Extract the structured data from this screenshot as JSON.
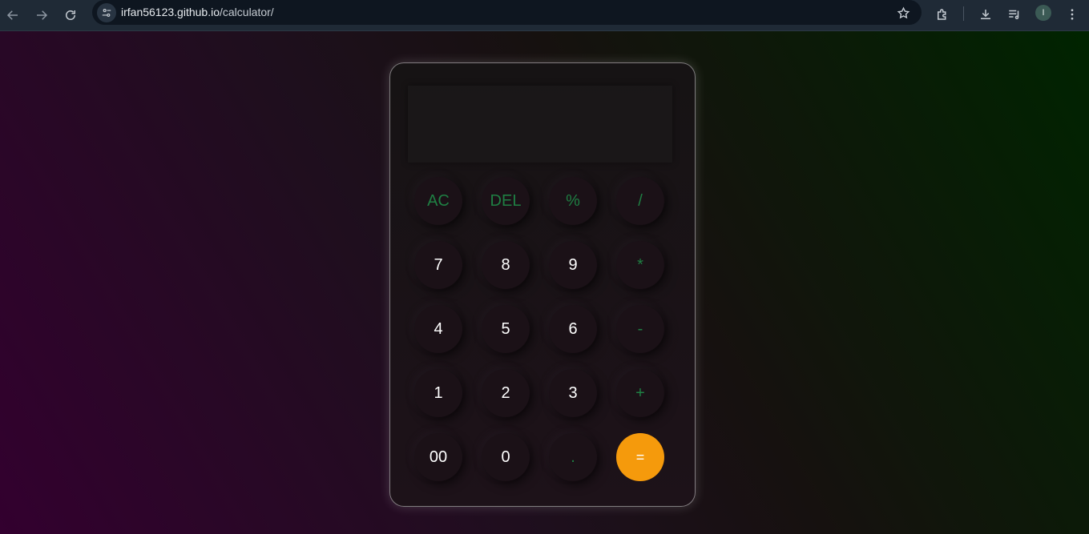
{
  "browser": {
    "url_host": "irfan56123.github.io",
    "url_path": "/calculator/",
    "profile_initial": "I",
    "icons": {
      "back": "arrow-left-icon",
      "forward": "arrow-right-icon",
      "reload": "reload-icon",
      "site_info": "tune-icon",
      "bookmark": "star-icon",
      "extensions": "puzzle-icon",
      "downloads": "download-icon",
      "reading_list": "playlist-icon",
      "menu": "kebab-menu-icon"
    }
  },
  "calculator": {
    "display_value": "",
    "keys": [
      {
        "label": "AC",
        "type": "operator"
      },
      {
        "label": "DEL",
        "type": "operator"
      },
      {
        "label": "%",
        "type": "operator"
      },
      {
        "label": "/",
        "type": "operator"
      },
      {
        "label": "7",
        "type": "digit"
      },
      {
        "label": "8",
        "type": "digit"
      },
      {
        "label": "9",
        "type": "digit"
      },
      {
        "label": "*",
        "type": "operator"
      },
      {
        "label": "4",
        "type": "digit"
      },
      {
        "label": "5",
        "type": "digit"
      },
      {
        "label": "6",
        "type": "digit"
      },
      {
        "label": "-",
        "type": "operator"
      },
      {
        "label": "1",
        "type": "digit"
      },
      {
        "label": "2",
        "type": "digit"
      },
      {
        "label": "3",
        "type": "digit"
      },
      {
        "label": "+",
        "type": "operator"
      },
      {
        "label": "00",
        "type": "digit"
      },
      {
        "label": "0",
        "type": "digit"
      },
      {
        "label": ".",
        "type": "operator"
      },
      {
        "label": "=",
        "type": "equals"
      }
    ],
    "colors": {
      "operator_text": "#1f7f43",
      "digit_text": "#ffffff",
      "equals_background": "#f59a0c",
      "key_background": "#1b1117"
    }
  }
}
